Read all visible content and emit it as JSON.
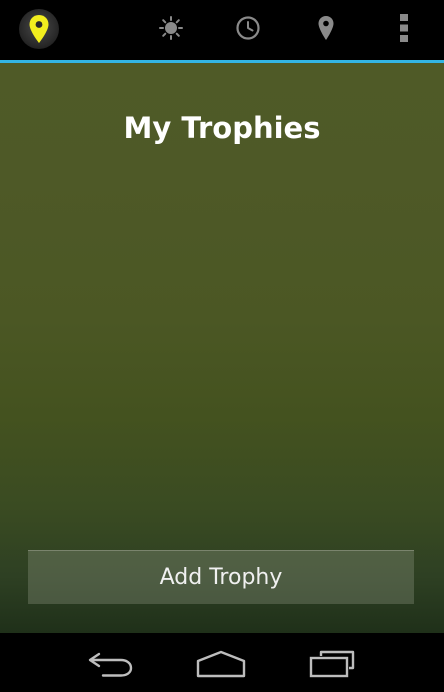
{
  "action_bar": {
    "app_icon": "map-pin-icon",
    "items": [
      {
        "icon": "sun-icon"
      },
      {
        "icon": "clock-icon"
      },
      {
        "icon": "location-pin-icon"
      },
      {
        "icon": "overflow-menu-icon"
      }
    ],
    "accent_color": "#33b5e5"
  },
  "main": {
    "title": "My Trophies",
    "add_button_label": "Add Trophy"
  },
  "nav_bar": {
    "items": [
      {
        "icon": "back-icon"
      },
      {
        "icon": "home-icon"
      },
      {
        "icon": "recent-apps-icon"
      }
    ]
  }
}
